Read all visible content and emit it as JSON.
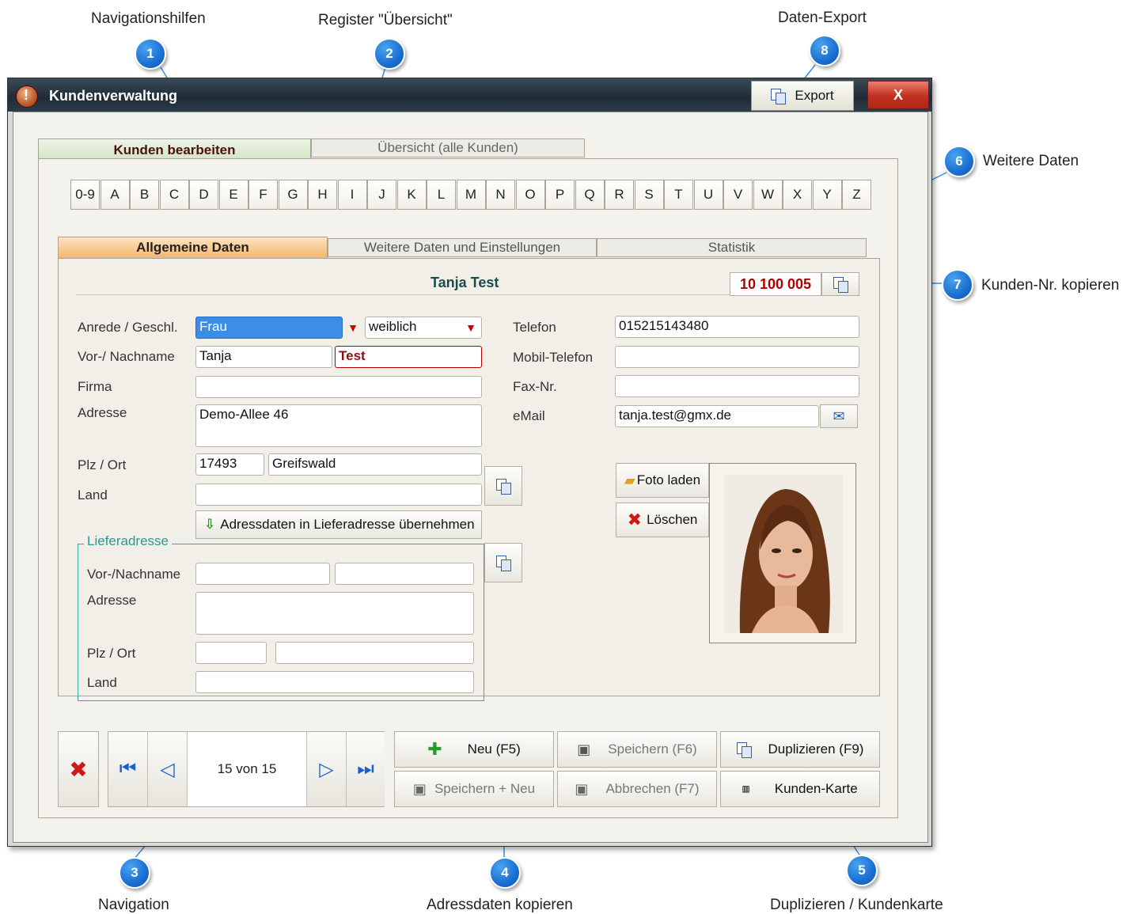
{
  "callouts": [
    {
      "num": "1",
      "label": "Navigationshilfen"
    },
    {
      "num": "2",
      "label": "Register \"Übersicht\""
    },
    {
      "num": "3",
      "label": "Navigation"
    },
    {
      "num": "4",
      "label": "Adressdaten kopieren"
    },
    {
      "num": "5",
      "label": "Duplizieren / Kundenkarte"
    },
    {
      "num": "6",
      "label": "Weitere Daten"
    },
    {
      "num": "7",
      "label": "Kunden-Nr. kopieren"
    },
    {
      "num": "8",
      "label": "Daten-Export"
    }
  ],
  "window": {
    "title": "Kundenverwaltung",
    "export_label": "Export",
    "close_label": "X"
  },
  "main_tabs": [
    "Kunden bearbeiten",
    "Übersicht (alle Kunden)"
  ],
  "alphabet": [
    "0-9",
    "A",
    "B",
    "C",
    "D",
    "E",
    "F",
    "G",
    "H",
    "I",
    "J",
    "K",
    "L",
    "M",
    "N",
    "O",
    "P",
    "Q",
    "R",
    "S",
    "T",
    "U",
    "V",
    "W",
    "X",
    "Y",
    "Z"
  ],
  "sub_tabs": [
    "Allgemeine Daten",
    "Weitere Daten und Einstellungen",
    "Statistik"
  ],
  "customer": {
    "name": "Tanja Test",
    "number": "10 100 005"
  },
  "form": {
    "anrede_label": "Anrede / Geschl.",
    "anrede_value": "Frau",
    "geschlecht_value": "weiblich",
    "name_label": "Vor-/ Nachname",
    "vorname": "Tanja",
    "nachname": "Test",
    "firma_label": "Firma",
    "firma": "",
    "adresse_label": "Adresse",
    "adresse": "Demo-Allee 46",
    "plzort_label": "Plz / Ort",
    "plz": "17493",
    "ort": "Greifswald",
    "land_label": "Land",
    "land": "",
    "copy_address_button": "Adressdaten in Lieferadresse übernehmen",
    "telefon_label": "Telefon",
    "telefon": "015215143480",
    "mobil_label": "Mobil-Telefon",
    "mobil": "",
    "fax_label": "Fax-Nr.",
    "fax": "",
    "email_label": "eMail",
    "email": "tanja.test@gmx.de",
    "foto_laden": "Foto laden",
    "loeschen": "Löschen"
  },
  "lieferadresse": {
    "legend": "Lieferadresse",
    "name_label": "Vor-/Nachname",
    "adresse_label": "Adresse",
    "plzort_label": "Plz / Ort",
    "land_label": "Land"
  },
  "navigation": {
    "position": "15 von 15"
  },
  "actions": {
    "neu": "Neu (F5)",
    "speichern": "Speichern (F6)",
    "duplizieren": "Duplizieren (F9)",
    "speichern_neu": "Speichern + Neu",
    "abbrechen": "Abbrechen (F7)",
    "kunden_karte": "Kunden-Karte"
  },
  "colors": {
    "accent_red": "#b00000",
    "callout_blue": "#1a6fd1",
    "teal_frame": "#3aa8a0",
    "active_tab": "#f7c58d"
  }
}
